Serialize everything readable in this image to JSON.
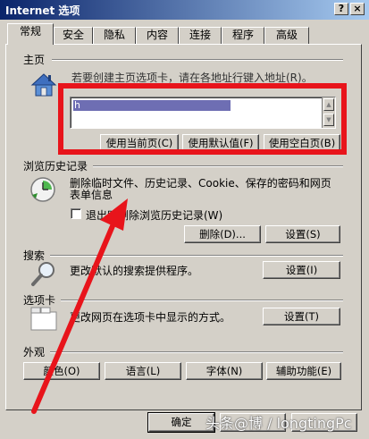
{
  "window": {
    "title": "Internet 选项",
    "help": "?",
    "close": "×"
  },
  "tabs": [
    "常规",
    "安全",
    "隐私",
    "内容",
    "连接",
    "程序",
    "高级"
  ],
  "homepage": {
    "heading": "主页",
    "description": "若要创建主页选项卡，请在各地址行键入地址(R)。",
    "address": "h",
    "buttons": {
      "use_current": "使用当前页(C)",
      "use_default": "使用默认值(F)",
      "use_blank": "使用空白页(B)"
    }
  },
  "history": {
    "heading": "浏览历史记录",
    "description_line1": "删除临时文件、历史记录、Cookie、保存的密码和网页",
    "description_line2": "表单信息",
    "checkbox_label": "退出时删除浏览历史记录(W)",
    "checkbox_checked": false,
    "buttons": {
      "delete": "删除(D)...",
      "settings": "设置(S)"
    }
  },
  "search": {
    "heading": "搜索",
    "description": "更改默认的搜索提供程序。",
    "settings": "设置(I)"
  },
  "tabs_section": {
    "heading": "选项卡",
    "description": "更改网页在选项卡中显示的方式。",
    "settings": "设置(T)"
  },
  "appearance": {
    "heading": "外观",
    "buttons": {
      "colors": "颜色(O)",
      "languages": "语言(L)",
      "fonts": "字体(N)",
      "accessibility": "辅助功能(E)"
    }
  },
  "footer": {
    "ok": "确定"
  },
  "watermark": "头条@博 / longtingPc",
  "colors": {
    "annotation": "#e8141b",
    "title_start": "#0a246a",
    "title_end": "#a6caf0",
    "face": "#d4d0c8"
  }
}
